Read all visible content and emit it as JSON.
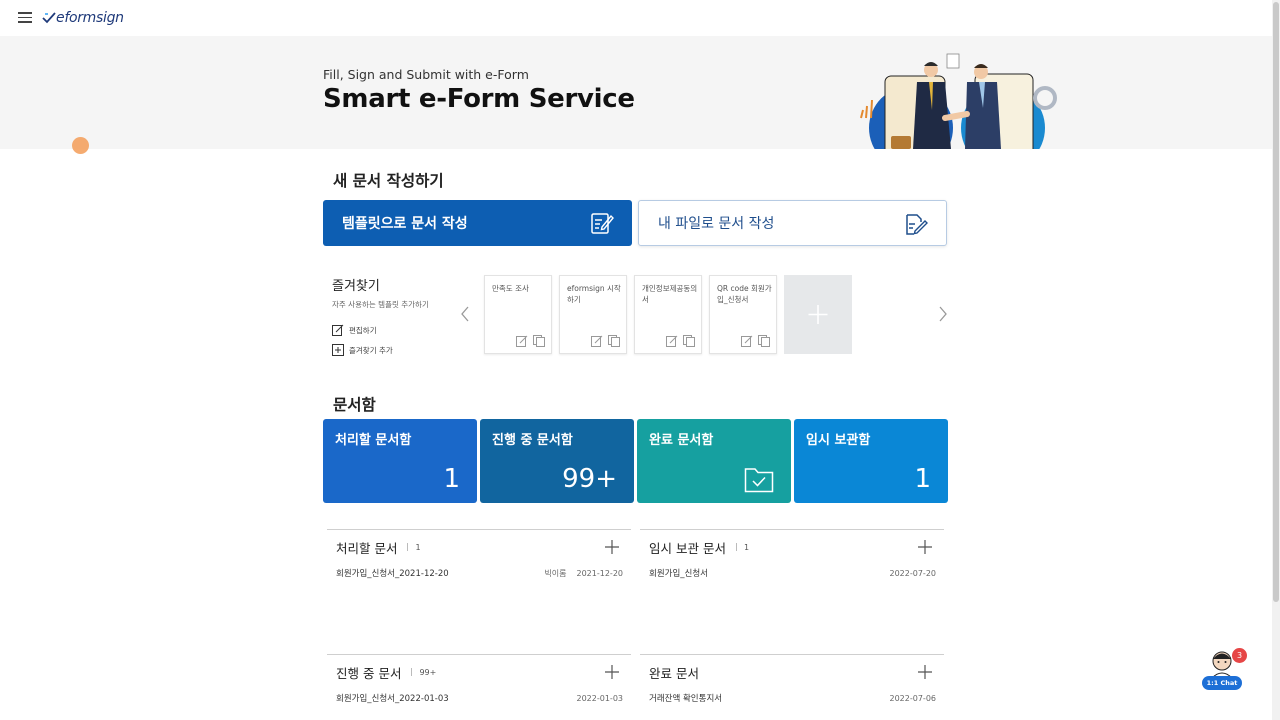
{
  "header": {
    "logo_brand": "eformsign"
  },
  "hero": {
    "tagline": "Fill, Sign and Submit with e-Form",
    "title": "Smart e-Form Service"
  },
  "create": {
    "section_title": "새 문서 작성하기",
    "template_button": "템플릿으로 문서 작성",
    "file_button": "내 파일로 문서 작성"
  },
  "favorites": {
    "title": "즐겨찾기",
    "subtitle": "자주 사용하는 템플릿 추가하기",
    "edit_label": "편집하기",
    "add_label": "즐겨찾기 추가",
    "templates": [
      {
        "name": "만족도 조사"
      },
      {
        "name": "eformsign 시작하기"
      },
      {
        "name": "개인정보제공동의서"
      },
      {
        "name": "QR code 회원가입_신청서"
      }
    ]
  },
  "document_boxes": {
    "section_title": "문서함",
    "boxes": [
      {
        "name": "처리할 문서함",
        "count": "1",
        "color": "#1a68c9"
      },
      {
        "name": "진행 중 문서함",
        "count": "99+",
        "color": "#11659f"
      },
      {
        "name": "완료 문서함",
        "count": "",
        "color": "#16a0a0",
        "icon": "folder-check-icon"
      },
      {
        "name": "임시 보관함",
        "count": "1",
        "color": "#0a87d6"
      }
    ]
  },
  "lists": {
    "todo": {
      "title": "처리할 문서",
      "count": "1",
      "rows": [
        {
          "title": "회원가입_신청서_2021-12-20",
          "writer": "빅이롬",
          "date": "2021-12-20"
        }
      ]
    },
    "draft": {
      "title": "임시 보관 문서",
      "count": "1",
      "rows": [
        {
          "title": "회원가입_신청서",
          "date": "2022-07-20"
        }
      ]
    },
    "progress": {
      "title": "진행 중 문서",
      "count": "99+",
      "rows": [
        {
          "title": "회원가입_신청서_2022-01-03",
          "date": "2022-01-03"
        }
      ]
    },
    "done": {
      "title": "완료 문서",
      "rows": [
        {
          "title": "거래잔액 확인통지서",
          "date": "2022-07-06"
        }
      ]
    }
  },
  "chat": {
    "label": "1:1 Chat",
    "badge": "3"
  }
}
